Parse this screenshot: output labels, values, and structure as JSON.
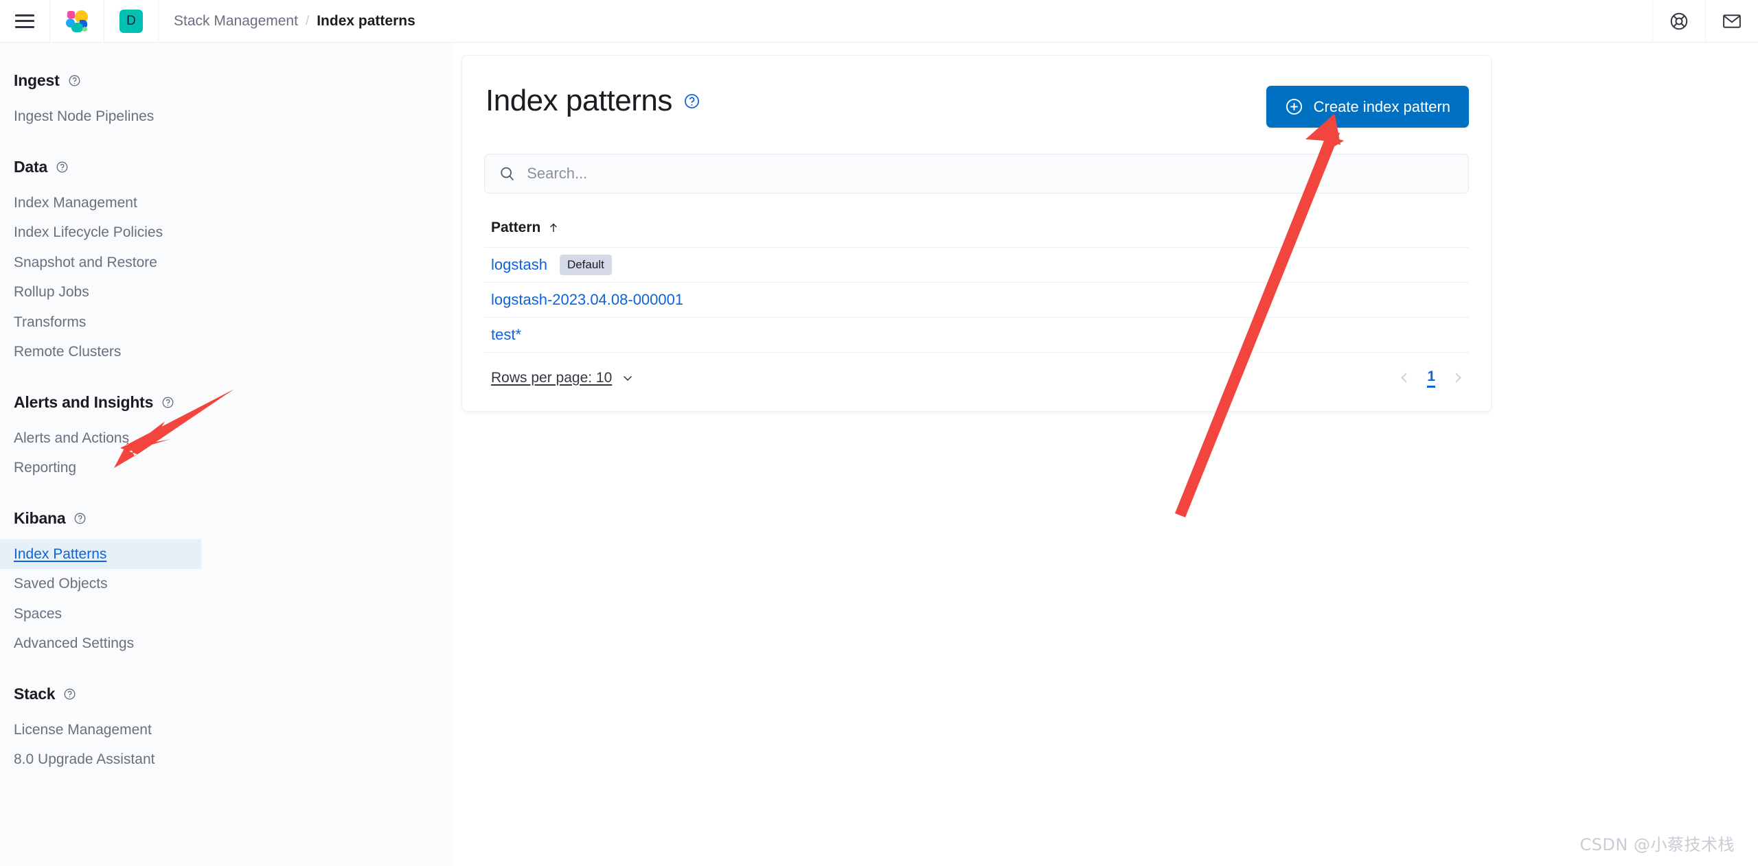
{
  "header": {
    "menu_icon": "hamburger-menu-icon",
    "logo_icon": "elastic-logo-icon",
    "space_badge": "D",
    "breadcrumbs": [
      {
        "label": "Stack Management",
        "active": false
      },
      {
        "label": "Index patterns",
        "active": true
      }
    ],
    "separator": "/",
    "help_icon": "help-lifebuoy-icon",
    "mail_icon": "mail-envelope-icon"
  },
  "sidebar": {
    "groups": [
      {
        "title": "Ingest",
        "help_icon": "question-circle-icon",
        "items": [
          {
            "label": "Ingest Node Pipelines",
            "selected": false
          }
        ]
      },
      {
        "title": "Data",
        "help_icon": "question-circle-icon",
        "items": [
          {
            "label": "Index Management",
            "selected": false
          },
          {
            "label": "Index Lifecycle Policies",
            "selected": false
          },
          {
            "label": "Snapshot and Restore",
            "selected": false
          },
          {
            "label": "Rollup Jobs",
            "selected": false
          },
          {
            "label": "Transforms",
            "selected": false
          },
          {
            "label": "Remote Clusters",
            "selected": false
          }
        ]
      },
      {
        "title": "Alerts and Insights",
        "help_icon": "question-circle-icon",
        "items": [
          {
            "label": "Alerts and Actions",
            "selected": false
          },
          {
            "label": "Reporting",
            "selected": false
          }
        ]
      },
      {
        "title": "Kibana",
        "help_icon": "question-circle-icon",
        "items": [
          {
            "label": "Index Patterns",
            "selected": true
          },
          {
            "label": "Saved Objects",
            "selected": false
          },
          {
            "label": "Spaces",
            "selected": false
          },
          {
            "label": "Advanced Settings",
            "selected": false
          }
        ]
      },
      {
        "title": "Stack",
        "help_icon": "question-circle-icon",
        "items": [
          {
            "label": "License Management",
            "selected": false
          },
          {
            "label": "8.0 Upgrade Assistant",
            "selected": false
          }
        ]
      }
    ]
  },
  "main": {
    "title": "Index patterns",
    "title_help_icon": "question-circle-icon",
    "create_button": {
      "label": "Create index pattern",
      "icon": "plus-in-circle-icon"
    },
    "search": {
      "placeholder": "Search...",
      "value": "",
      "icon": "search-icon"
    },
    "table": {
      "columns": [
        {
          "label": "Pattern",
          "sort_icon": "arrow-up-icon",
          "sorted": true
        }
      ],
      "rows": [
        {
          "pattern": "logstash",
          "badge": "Default"
        },
        {
          "pattern": "logstash-2023.04.08-000001",
          "badge": ""
        },
        {
          "pattern": "test*",
          "badge": ""
        }
      ]
    },
    "footer": {
      "rows_per_page_label": "Rows per page: 10",
      "rows_per_page_icon": "chevron-down-icon",
      "prev_icon": "chevron-left-icon",
      "next_icon": "chevron-right-icon",
      "current_page": "1"
    }
  },
  "annotations": {
    "arrow_color": "#f2453d",
    "arrow_to_sidebar": "arrow-pointing-to-index-patterns",
    "arrow_to_create": "arrow-pointing-to-create-index-pattern-button"
  },
  "watermark": {
    "text": "CSDN @小蔡技术栈"
  },
  "colors": {
    "accent_blue": "#0071c2",
    "link_blue": "#0b64dd",
    "teal": "#00bfb3",
    "annotation_red": "#f2453d",
    "sidebar_bg": "#fafbfd",
    "selected_bg": "#e6f0f8"
  }
}
